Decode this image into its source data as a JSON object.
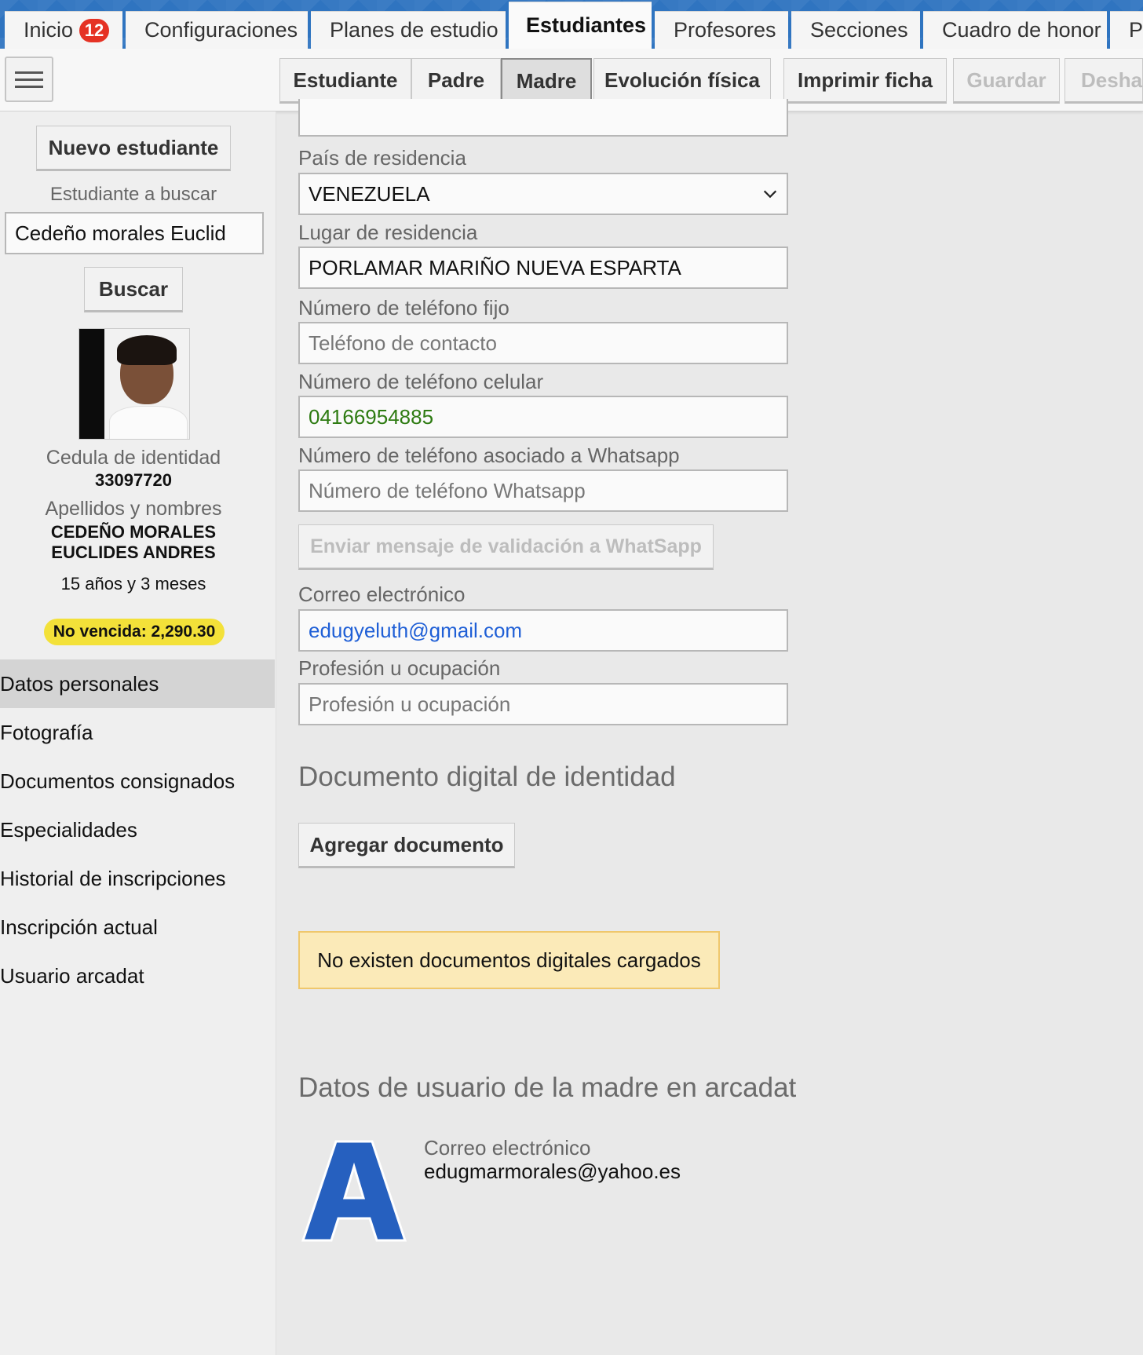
{
  "tabs": [
    {
      "label": "Inicio",
      "badge": "12"
    },
    {
      "label": "Configuraciones"
    },
    {
      "label": "Planes de estudio"
    },
    {
      "label": "Estudiantes"
    },
    {
      "label": "Profesores"
    },
    {
      "label": "Secciones"
    },
    {
      "label": "Cuadro de honor"
    },
    {
      "label": "P"
    }
  ],
  "toolbar": {
    "student": "Estudiante",
    "father": "Padre",
    "mother": "Madre",
    "physical": "Evolución física",
    "print": "Imprimir ficha",
    "save": "Guardar",
    "undo": "Deshac"
  },
  "sidebar": {
    "new_student": "Nuevo estudiante",
    "search_label": "Estudiante a buscar",
    "search_value": "Cedeño morales Euclid",
    "search_button": "Buscar",
    "id_label": "Cedula de identidad",
    "id_value": "33097720",
    "names_label": "Apellidos y nombres",
    "name_line1": "CEDEÑO MORALES",
    "name_line2": "EUCLIDES ANDRES",
    "age": "15 años y 3 meses",
    "balance": "No vencida: 2,290.30",
    "menu": [
      "Datos personales",
      "Fotografía",
      "Documentos consignados",
      "Especialidades",
      "Historial de inscripciones",
      "Inscripción actual",
      "Usuario arcadat"
    ]
  },
  "form": {
    "country_label": "País de residencia",
    "country_value": "VENEZUELA",
    "place_label": "Lugar de residencia",
    "place_value": "PORLAMAR MARIÑO NUEVA ESPARTA",
    "landline_label": "Número de teléfono fijo",
    "landline_placeholder": "Teléfono de contacto",
    "mobile_label": "Número de teléfono celular",
    "mobile_value": "04166954885",
    "whatsapp_label": "Número de teléfono asociado a Whatsapp",
    "whatsapp_placeholder": "Número de teléfono Whatsapp",
    "whatsapp_button": "Enviar mensaje de validación a WhatSapp",
    "email_label": "Correo electrónico",
    "email_value": "edugyeluth@gmail.com",
    "profession_label": "Profesión u ocupación",
    "profession_placeholder": "Profesión u ocupación"
  },
  "digital_doc": {
    "title": "Documento digital de identidad",
    "add_button": "Agregar documento",
    "notice": "No existen documentos digitales cargados"
  },
  "arcadat_user": {
    "title": "Datos de usuario de la madre en arcadat",
    "logo_letter": "A",
    "email_label": "Correo electrónico",
    "email_value": "edugmarmorales@yahoo.es"
  },
  "colors": {
    "topbar": "#2f74c0",
    "badge": "#e53224",
    "pill": "#f3e139",
    "notice_bg": "#fbeab8",
    "link_blue": "#1f5fd6",
    "phone_green": "#2e7b12",
    "logo_blue": "#2660bf"
  }
}
